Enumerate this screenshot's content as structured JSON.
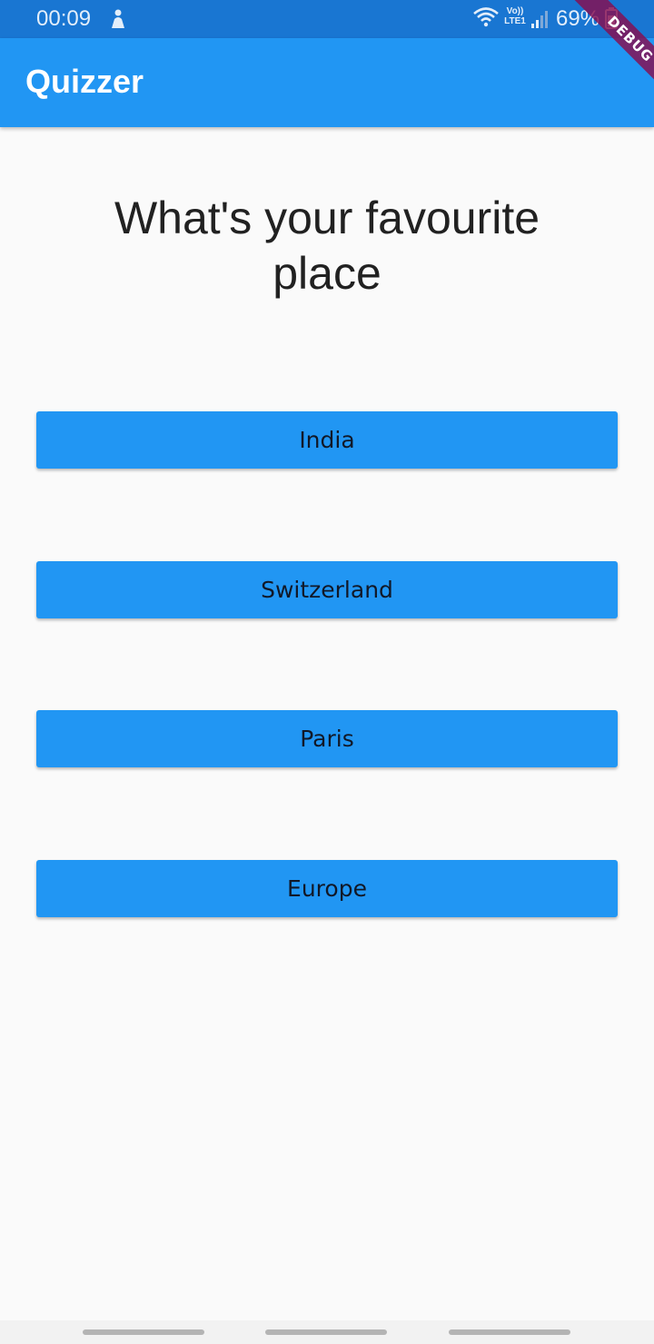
{
  "status_bar": {
    "time": "00:09",
    "network_label": "Vo)) LTE1",
    "battery_percent": "69%",
    "icons": [
      "notification-icon",
      "wifi-icon",
      "signal-icon",
      "battery-icon"
    ]
  },
  "app_bar": {
    "title": "Quizzer",
    "color": "#2196f3"
  },
  "debug_banner": {
    "label": "DEBUG"
  },
  "quiz": {
    "question": "What's your favourite place",
    "answers": [
      "India",
      "Switzerland",
      "Paris",
      "Europe"
    ]
  },
  "nav_bar": {
    "handles": 3
  },
  "colors": {
    "primary": "#2196f3",
    "status_bar": "#1976d2",
    "background": "#fafafa",
    "debug": "#880e4f"
  }
}
